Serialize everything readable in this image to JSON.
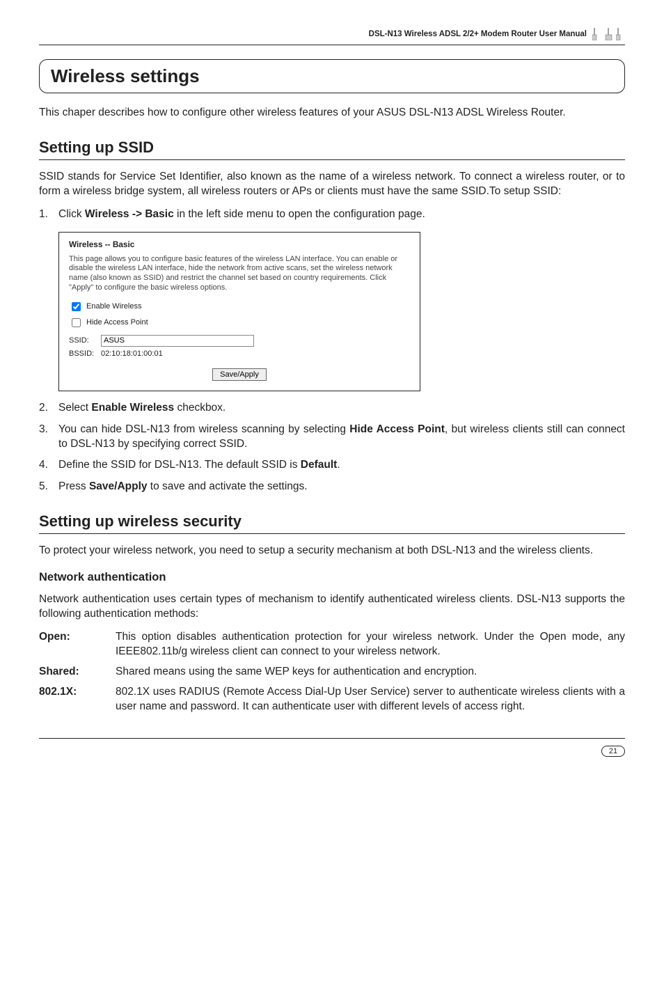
{
  "header": {
    "text": "DSL-N13 Wireless ADSL 2/2+ Modem Router User Manual"
  },
  "section_title": "Wireless settings",
  "intro": "This chaper describes how to configure other wireless features of your ASUS DSL-N13 ADSL Wireless Router.",
  "ssid_section": {
    "title": "Setting up SSID",
    "para": "SSID stands for Service Set Identifier, also known as the name of a wireless network. To connect a wireless router, or to form a wireless bridge system, all wireless routers or APs or clients must have the same SSID.To setup SSID:",
    "step1_pre": "Click ",
    "step1_bold": "Wireless -> Basic",
    "step1_post": " in the left side menu to open the configuration page.",
    "screenshot": {
      "title": "Wireless -- Basic",
      "desc": "This page allows you to configure basic features of the wireless LAN interface. You can enable or disable the wireless LAN interface, hide the network from active scans, set the wireless network name (also known as SSID) and restrict the channel set based on country requirements.\nClick \"Apply\" to configure the basic wireless options.",
      "enable_label": "Enable Wireless",
      "enable_checked": true,
      "hide_label": "Hide Access Point",
      "hide_checked": false,
      "ssid_label": "SSID:",
      "ssid_value": "ASUS",
      "bssid_label": "BSSID:",
      "bssid_value": "02:10:18:01:00:01",
      "button": "Save/Apply"
    },
    "step2_pre": "Select ",
    "step2_bold": "Enable Wireless",
    "step2_post": " checkbox.",
    "step3_pre": "You can hide DSL-N13 from wireless scanning by selecting ",
    "step3_bold": "Hide Access Point",
    "step3_post": ", but wireless clients still can connect to DSL-N13 by specifying correct SSID.",
    "step4_pre": "Define the SSID for DSL-N13. The default SSID is ",
    "step4_bold": "Default",
    "step4_post": ".",
    "step5_pre": "Press ",
    "step5_bold": "Save/Apply",
    "step5_post": " to save and activate the settings."
  },
  "security_section": {
    "title": "Setting up wireless security",
    "para": "To protect your wireless network, you need to setup a security mechanism at both DSL-N13 and the wireless clients.",
    "netauth_title": "Network authentication",
    "netauth_para": "Network authentication uses certain types of mechanism to identify authenticated wireless clients. DSL-N13 supports the following authentication methods:",
    "defs": {
      "open_term": "Open:",
      "open_body": "This option disables authentication protection for your wireless network. Under the Open mode, any IEEE802.11b/g wireless client can connect to your wireless network.",
      "shared_term": "Shared:",
      "shared_body": "Shared means using the same WEP keys for authentication and encryption.",
      "x_term": "802.1X:",
      "x_body": "802.1X uses RADIUS (Remote Access Dial-Up User Service) server to authenticate wireless clients with a user name and password. It can authenticate user with different levels of access right."
    }
  },
  "page_number": "21"
}
